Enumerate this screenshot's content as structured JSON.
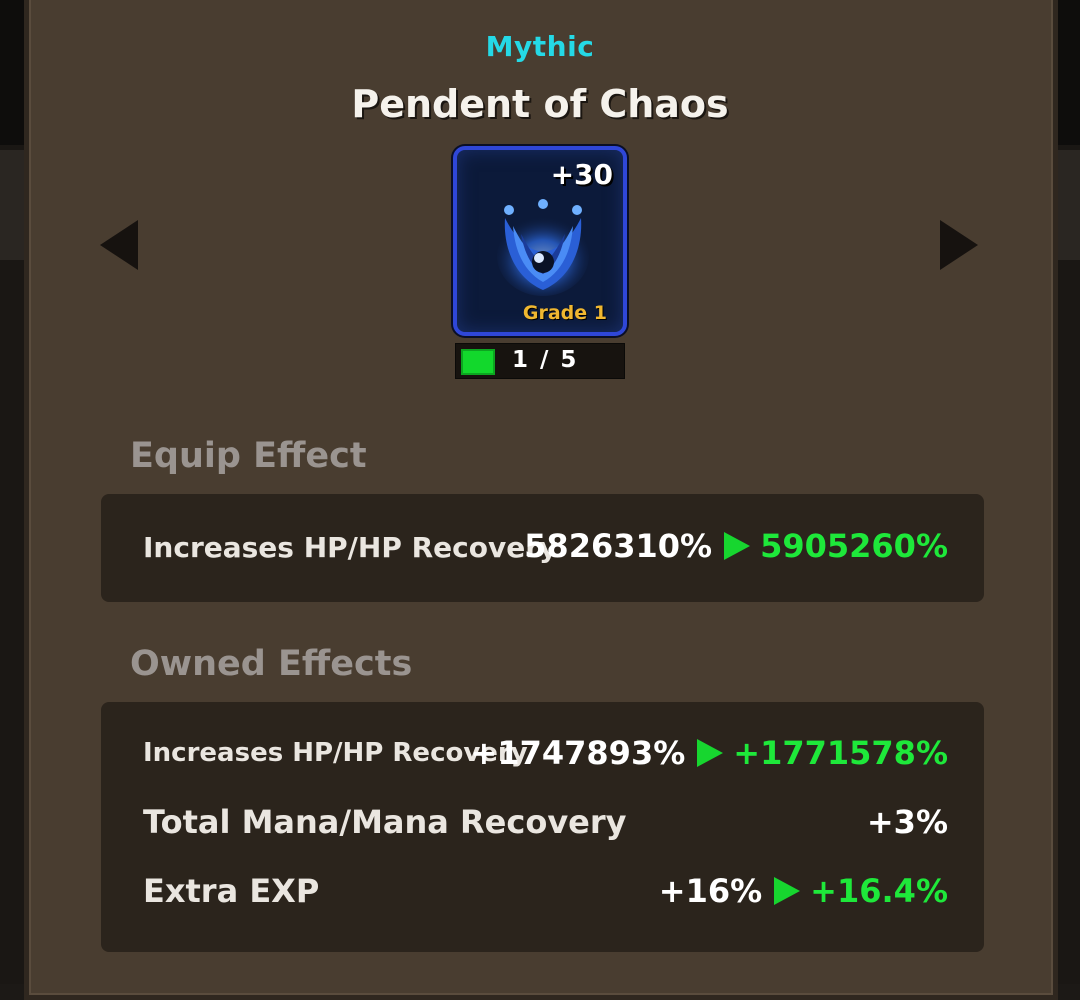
{
  "item": {
    "rarity": "Mythic",
    "name": "Pendent of Chaos",
    "enhance": "+30",
    "grade": "Grade 1",
    "count": "1 / 5",
    "colors": {
      "rarity": "#25d9e6",
      "slot_border": "#2f47d8",
      "grade": "#f0b730",
      "increase": "#1ee83a"
    },
    "icon": "pendant-icon"
  },
  "navigation": {
    "prev_icon": "arrow-left-icon",
    "next_icon": "arrow-right-icon"
  },
  "equip_effect": {
    "title": "Equip Effect",
    "rows": [
      {
        "label": "Increases HP/HP Recovery",
        "current": "5826310%",
        "next": "5905260%"
      }
    ]
  },
  "owned_effects": {
    "title": "Owned Effects",
    "rows": [
      {
        "label": "Increases HP/HP Recovery",
        "current": "+1747893%",
        "next": "+1771578%"
      },
      {
        "label": "Total Mana/Mana Recovery",
        "current": "+3%",
        "next": ""
      },
      {
        "label": "Extra EXP",
        "current": "+16%",
        "next": "+16.4%"
      }
    ]
  }
}
